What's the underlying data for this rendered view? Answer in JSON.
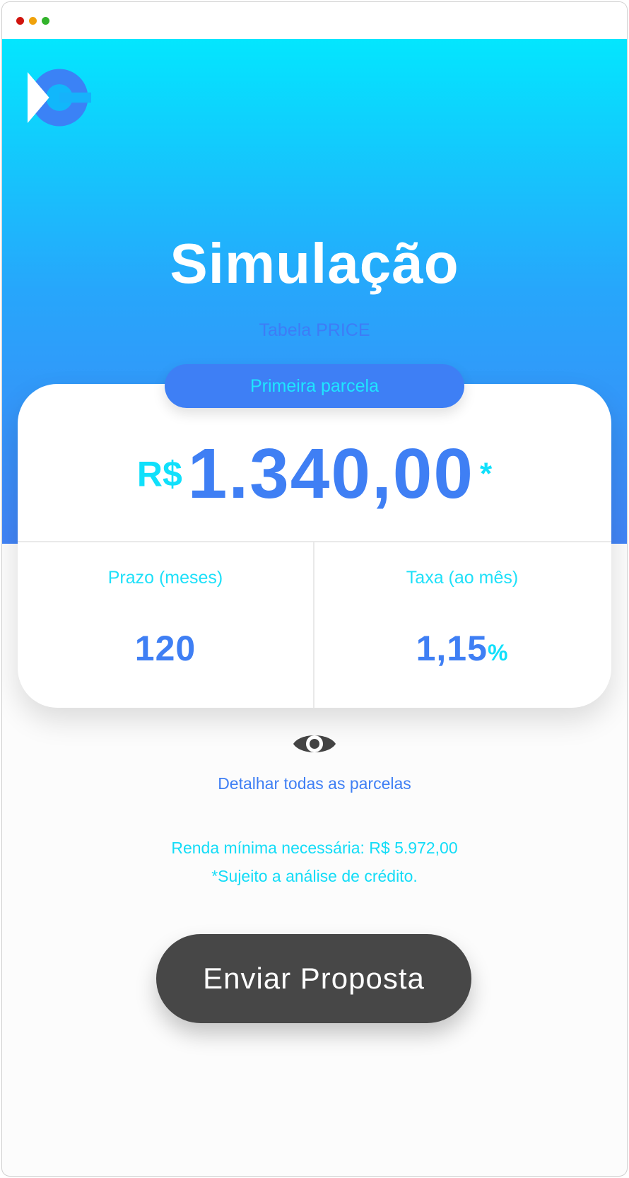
{
  "header": {
    "title": "Simulação",
    "subtitle": "Tabela PRICE"
  },
  "logo": {
    "icon": "brand-c-logo-icon"
  },
  "card": {
    "badge_label": "Primeira parcela",
    "amount_currency": "R$",
    "amount_value": "1.340,00",
    "amount_note_mark": "*",
    "term": {
      "label": "Prazo (meses)",
      "value": "120"
    },
    "rate": {
      "label": "Taxa (ao mês)",
      "value": "1,15",
      "unit": "%"
    }
  },
  "details": {
    "icon": "eye-icon",
    "link_label": "Detalhar todas as parcelas"
  },
  "info": {
    "min_income": "Renda mínima necessária: R$ 5.972,00",
    "disclaimer": "*Sujeito a análise de crédito."
  },
  "actions": {
    "submit_label": "Enviar Proposta"
  },
  "colors": {
    "gradient_top": "#03e6fe",
    "gradient_bottom": "#4284f6",
    "primary_blue": "#3f7ff4",
    "accent_cyan": "#10e0fb",
    "button_dark": "#474747"
  }
}
